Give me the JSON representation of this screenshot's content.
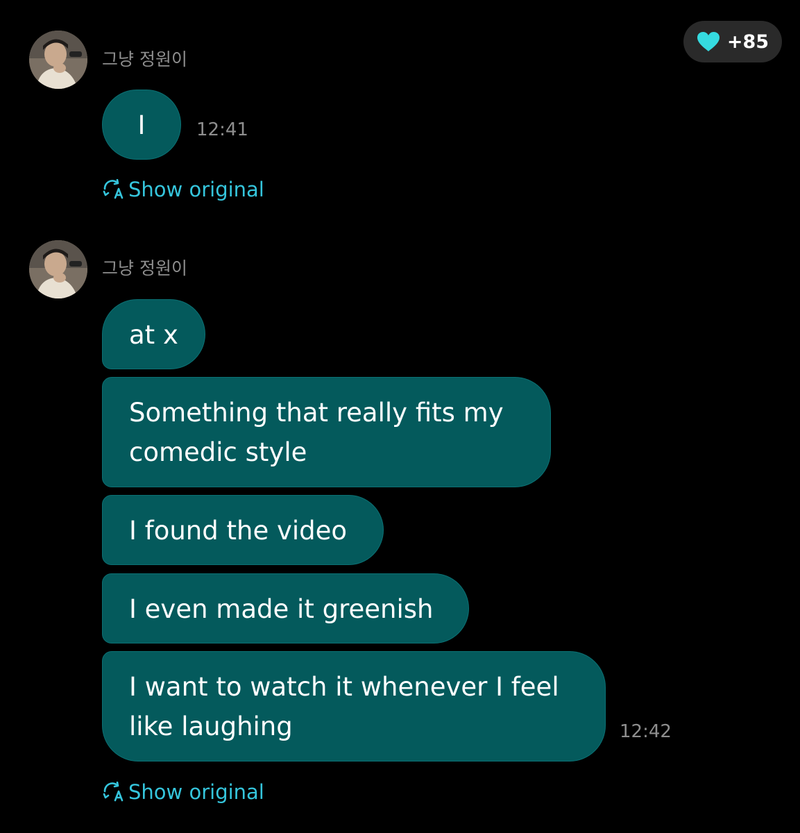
{
  "badge": {
    "label": "+85",
    "icon": "heart-icon",
    "color": "#35dbe0"
  },
  "accent_color": "#35c5dc",
  "bubble_color": "#045a5c",
  "groups": [
    {
      "sender": "그냥 정원이",
      "messages": [
        {
          "text": "I",
          "time": "12:41"
        }
      ],
      "show_original": "Show original"
    },
    {
      "sender": "그냥 정원이",
      "messages": [
        {
          "text": "at x"
        },
        {
          "text": "Something that really fits my comedic style"
        },
        {
          "text": "I found the video"
        },
        {
          "text": "I even made it greenish"
        },
        {
          "text": "I want to watch it whenever I feel like laughing",
          "time": "12:42"
        }
      ],
      "show_original": "Show original"
    }
  ]
}
